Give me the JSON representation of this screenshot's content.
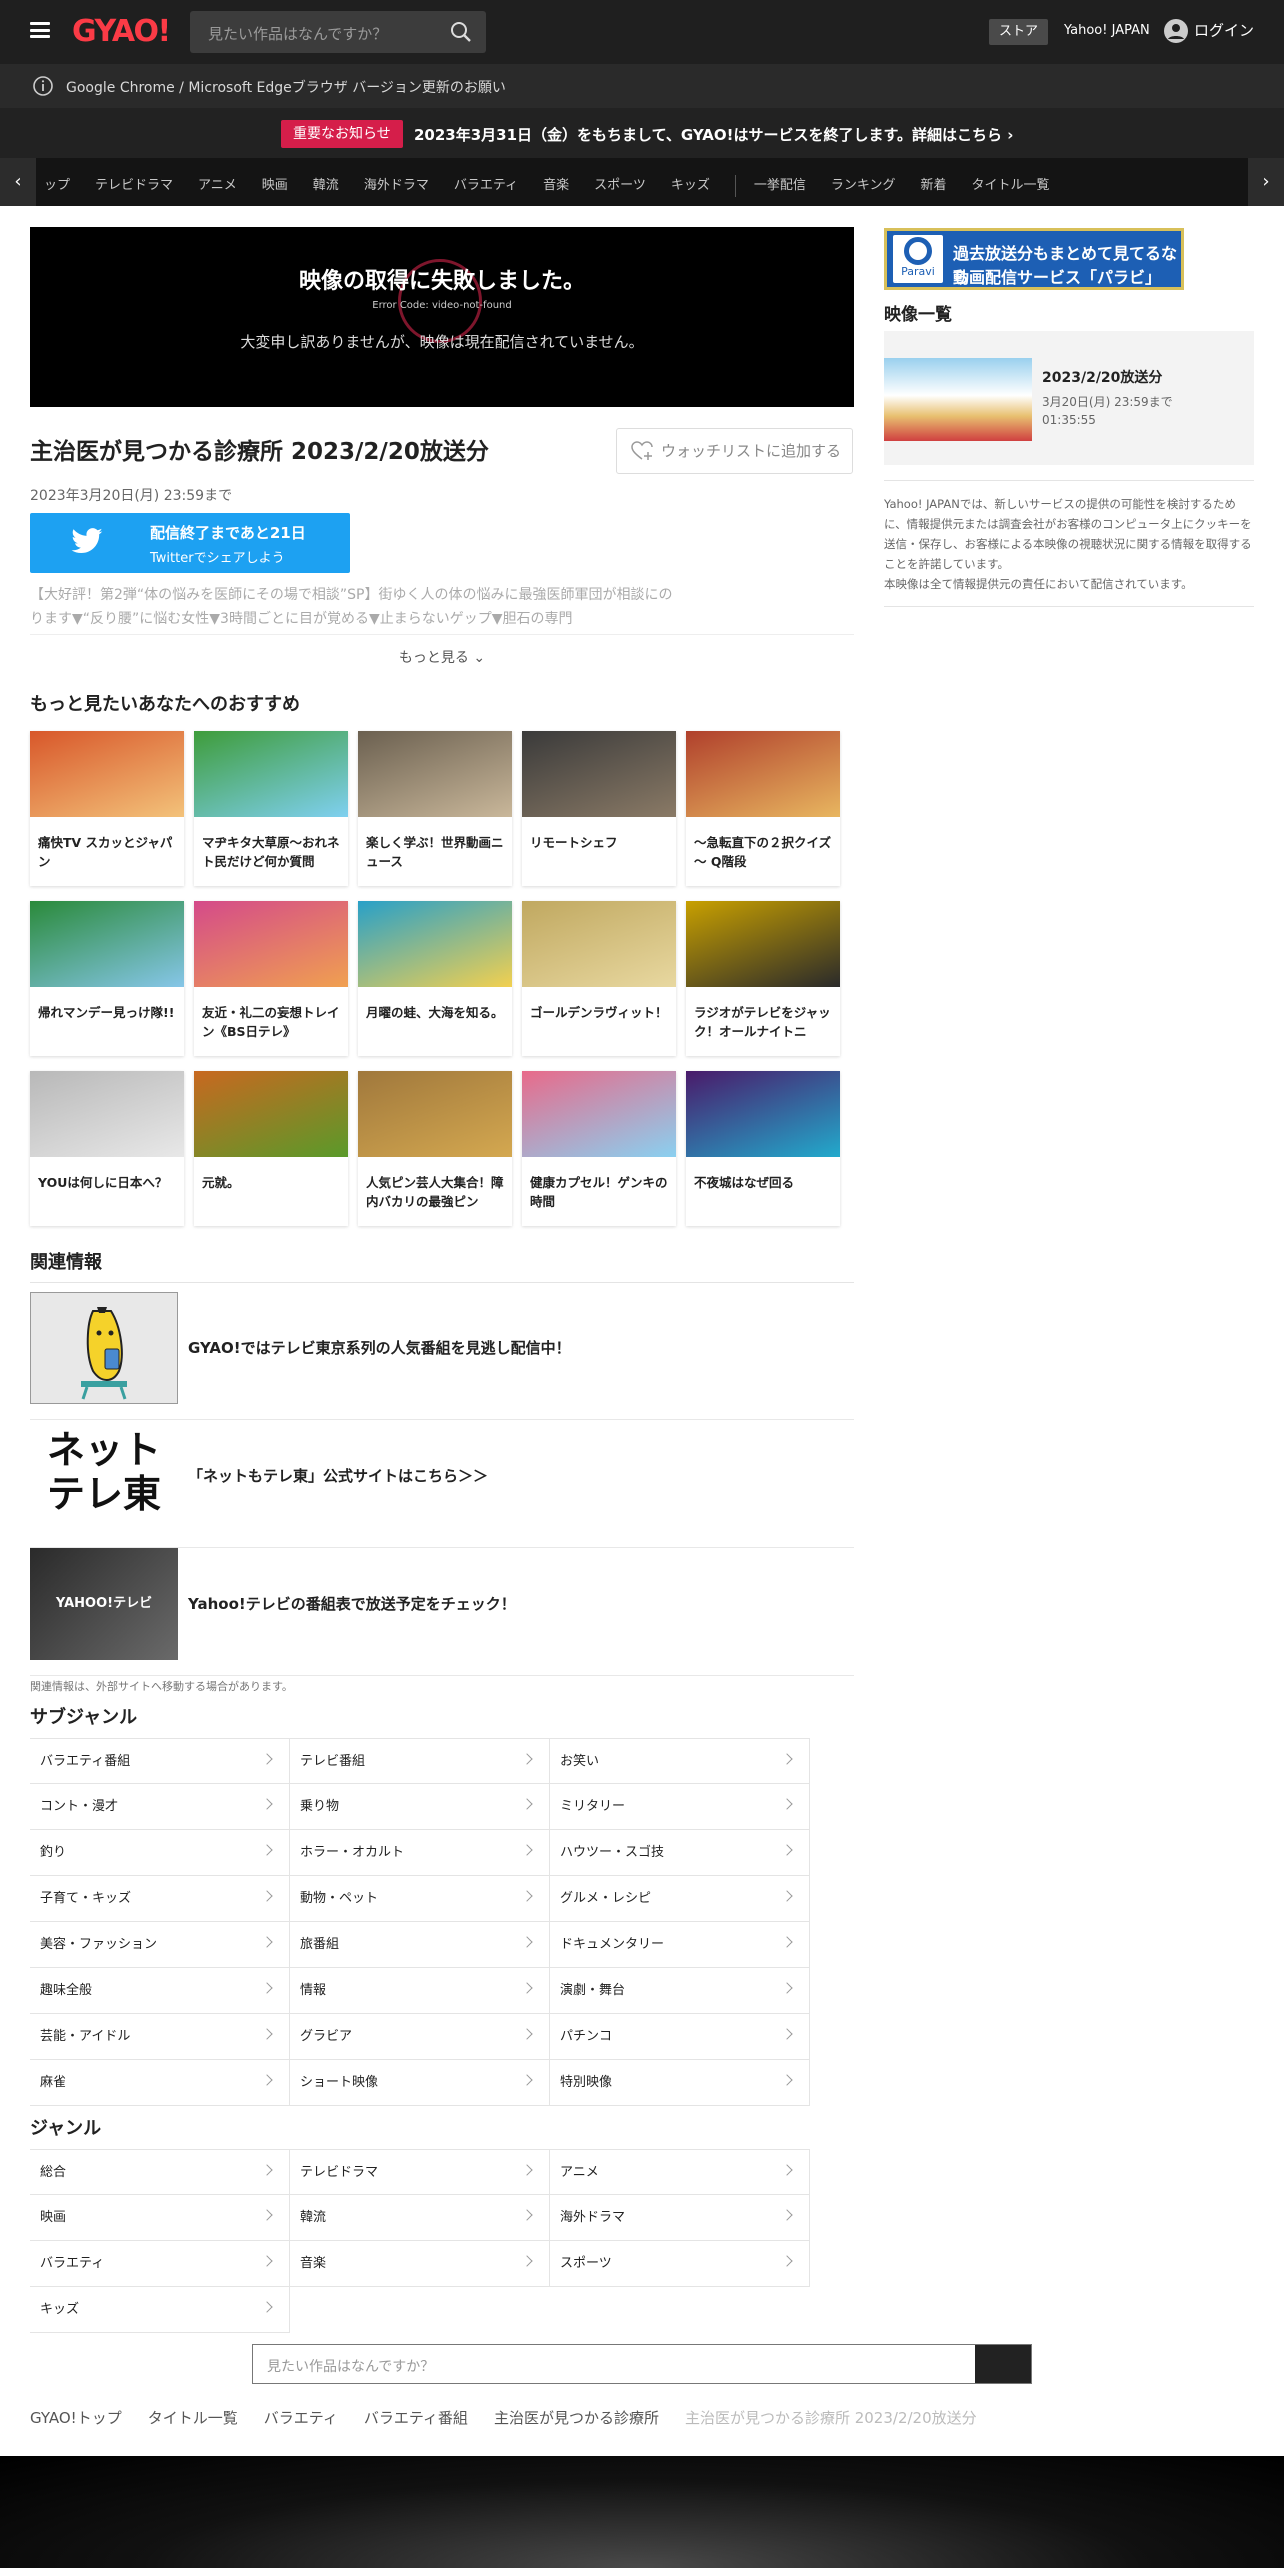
{
  "header": {
    "logo": "GYAO!",
    "search_placeholder": "見たい作品はなんですか？",
    "store": "ストア",
    "yahoo": "Yahoo! JAPAN",
    "login": "ログイン"
  },
  "browser_notice": "Google Chrome / Microsoft Edgeブラウザ バージョン更新のお願い",
  "notice": {
    "badge": "重要なお知らせ",
    "message": "2023年3月31日（金）をもちまして、GYAO!はサービスを終了します。詳細はこちら"
  },
  "nav": {
    "items": [
      "ップ",
      "テレビドラマ",
      "アニメ",
      "映画",
      "韓流",
      "海外ドラマ",
      "バラエティ",
      "音楽",
      "スポーツ",
      "キッズ"
    ],
    "items2": [
      "一挙配信",
      "ランキング",
      "新着",
      "タイトル一覧"
    ]
  },
  "player": {
    "error_title": "映像の取得に失敗しました。",
    "error_code": "Error Code: video-not-found",
    "error_message": "大変申し訳ありませんが、映像は現在配信されていません。"
  },
  "program": {
    "title": "主治医が見つかる診療所 2023/2/20放送分",
    "watchlist": "ウォッチリストに追加する",
    "date": "2023年3月20日(月) 23:59まで",
    "twitter_l1": "配信終了まであと21日",
    "twitter_l2": "Twitterでシェアしよう",
    "description": "【大好評！第2弾“体の悩みを医師にその場で相談”SP】街ゆく人の体の悩みに最強医師軍団が相談にのります▼“反り腰”に悩む女性▼3時間ごとに目が覚める▼止まらないゲップ▼胆石の専門",
    "more": "もっと見る"
  },
  "recommend": {
    "title": "もっと見たいあなたへのおすすめ",
    "items": [
      {
        "label": "痛快TV スカッとジャパン",
        "c1": "#d8572a",
        "c2": "#f3c27a"
      },
      {
        "label": "マヂキタ大草原～おれネト民だけど何か質問",
        "c1": "#3e9c3a",
        "c2": "#7fd0f0"
      },
      {
        "label": "楽しく学ぶ！世界動画ニュース",
        "c1": "#6b6050",
        "c2": "#c9b79a"
      },
      {
        "label": "リモートシェフ",
        "c1": "#3a3a3a",
        "c2": "#8a7a66"
      },
      {
        "label": "～急転直下の２択クイズ～ Q階段",
        "c1": "#b0402c",
        "c2": "#e8b660"
      },
      {
        "label": "帰れマンデー見っけ隊!!",
        "c1": "#2a8a3a",
        "c2": "#86c6e8"
      },
      {
        "label": "友近・礼二の妄想トレイン《BS日テレ》",
        "c1": "#d44a8a",
        "c2": "#f0a050"
      },
      {
        "label": "月曜の蛙、大海を知る。",
        "c1": "#28a0c8",
        "c2": "#f2d050"
      },
      {
        "label": "ゴールデンラヴィット！",
        "c1": "#c0a860",
        "c2": "#e8d8a0"
      },
      {
        "label": "ラジオがテレビをジャック！オールナイトニ",
        "c1": "#c8a000",
        "c2": "#2a2a2a"
      },
      {
        "label": "YOUは何しに日本へ？",
        "c1": "#b8b8b8",
        "c2": "#e8e8e8"
      },
      {
        "label": "元就。",
        "c1": "#c86820",
        "c2": "#5a9a2a"
      },
      {
        "label": "人気ピン芸人大集合！障内バカリの最強ピン",
        "c1": "#a0783c",
        "c2": "#d4a850"
      },
      {
        "label": "健康カプセル！ゲンキの時間",
        "c1": "#e86a8a",
        "c2": "#8ad0f0"
      },
      {
        "label": "不夜城はなぜ回る",
        "c1": "#4a1a6a",
        "c2": "#22aacc"
      }
    ]
  },
  "related": {
    "title": "関連情報",
    "items": [
      "GYAO!ではテレビ東京系列の人気番組を見逃し配信中！",
      "「ネットもテレ東」公式サイトはこちら＞＞",
      "Yahoo!テレビの番組表で放送予定をチェック！"
    ],
    "img2_l1": "ネット",
    "img2_l2": "テレ東",
    "img3_l1": "YAHOO!テレビ",
    "note": "関連情報は、外部サイトへ移動する場合があります。"
  },
  "subgenre": {
    "title": "サブジャンル",
    "items": [
      "バラエティ番組",
      "テレビ番組",
      "お笑い",
      "コント・漫才",
      "乗り物",
      "ミリタリー",
      "釣り",
      "ホラー・オカルト",
      "ハウツー・スゴ技",
      "子育て・キッズ",
      "動物・ペット",
      "グルメ・レシピ",
      "美容・ファッション",
      "旅番組",
      "ドキュメンタリー",
      "趣味全般",
      "情報",
      "演劇・舞台",
      "芸能・アイドル",
      "グラビア",
      "パチンコ",
      "麻雀",
      "ショート映像",
      "特別映像"
    ]
  },
  "genre": {
    "title": "ジャンル",
    "items": [
      "総合",
      "テレビドラマ",
      "アニメ",
      "映画",
      "韓流",
      "海外ドラマ",
      "バラエティ",
      "音楽",
      "スポーツ",
      "キッズ"
    ]
  },
  "bottom_search_placeholder": "見たい作品はなんですか？",
  "breadcrumbs": [
    "GYAO!トップ",
    "タイトル一覧",
    "バラエティ",
    "バラエティ番組",
    "主治医が見つかる診療所",
    "主治医が見つかる診療所 2023/2/20放送分"
  ],
  "sidebar": {
    "paravi_l1": "過去放送分もまとめて見てるなら",
    "paravi_l2": "動画配信サービス「パラビ」",
    "paravi_logo": "Paravi",
    "videos_title": "映像一覧",
    "video_title": "2023/2/20放送分",
    "video_date": "3月20日(月) 23:59まで",
    "video_length": "01:35:55",
    "note": "Yahoo! JAPANでは、新しいサービスの提供の可能性を検討するために、情報提供元または調査会社がお客様のコンピュータ上にクッキーを送信・保存し、お客様による本映像の視聴状況に関する情報を取得することを許諾しています。",
    "note2": "本映像は全て情報提供元の責任において配信されています。"
  }
}
